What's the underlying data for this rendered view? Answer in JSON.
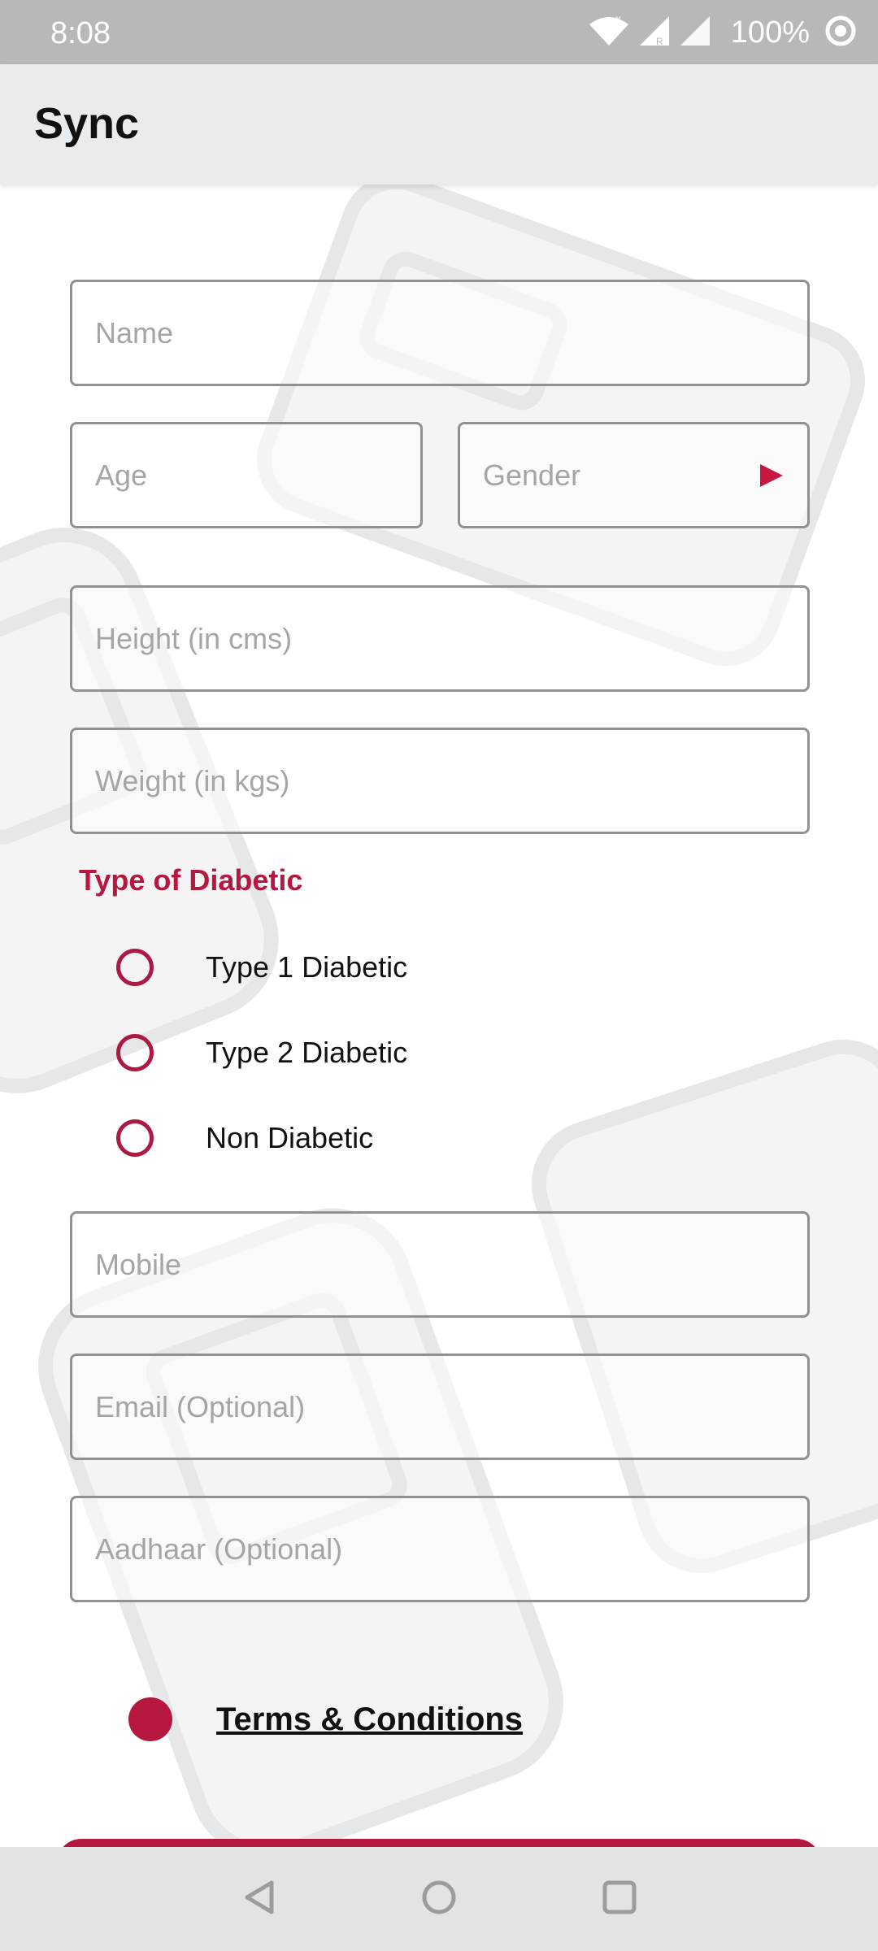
{
  "status_bar": {
    "time": "8:08",
    "battery": "100%"
  },
  "app_bar": {
    "title": "Sync"
  },
  "form": {
    "name_placeholder": "Name",
    "age_placeholder": "Age",
    "gender_placeholder": "Gender",
    "height_placeholder": "Height (in cms)",
    "weight_placeholder": "Weight (in kgs)",
    "diabetic_section_label": "Type of Diabetic",
    "diabetic_options": [
      {
        "label": "Type 1 Diabetic",
        "selected": false
      },
      {
        "label": "Type 2 Diabetic",
        "selected": false
      },
      {
        "label": "Non Diabetic",
        "selected": false
      }
    ],
    "mobile_placeholder": "Mobile",
    "email_placeholder": "Email (Optional)",
    "aadhaar_placeholder": "Aadhaar (Optional)",
    "terms_label": "Terms & Conditions"
  },
  "colors": {
    "accent": "#b5173f",
    "status_bar": "#b6b8ba",
    "app_bar": "#e9ecee",
    "field_border": "#8f9194"
  },
  "icons": {
    "status": [
      "wifi-icon",
      "signal-icon",
      "signal-icon",
      "focus-mode-icon"
    ],
    "nav": [
      "back-icon",
      "home-icon",
      "recents-icon"
    ],
    "gender_dropdown": "caret-right-icon"
  }
}
